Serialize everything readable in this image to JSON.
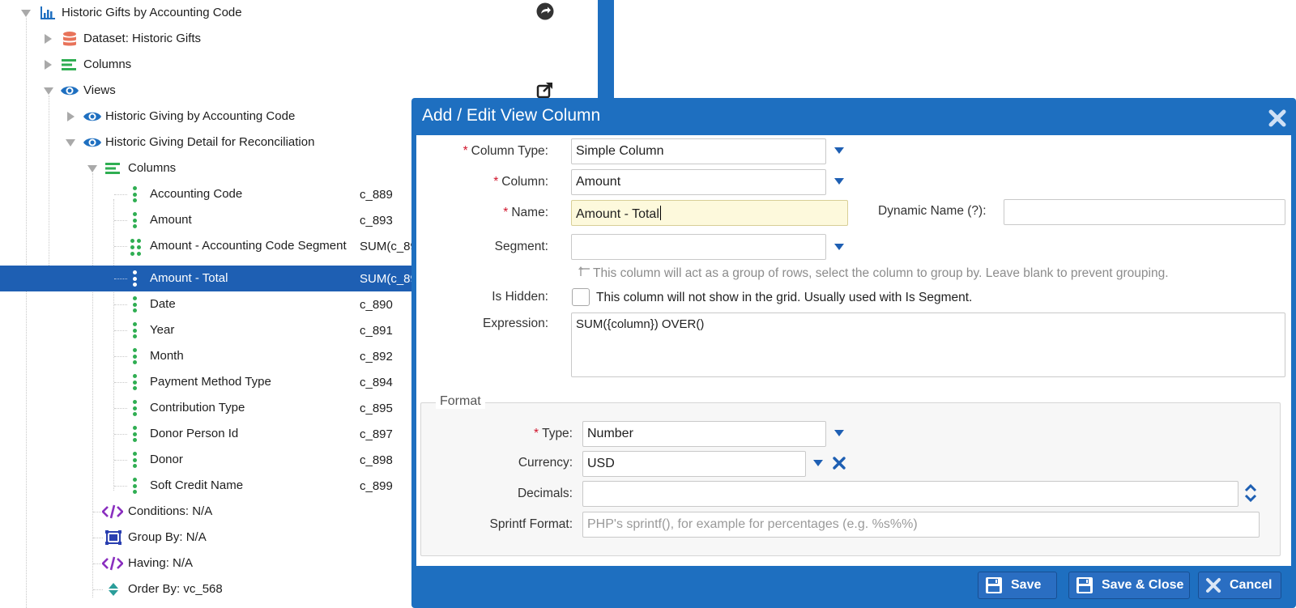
{
  "tree": {
    "root": {
      "label": "Historic Gifts by Accounting Code"
    },
    "dataset": {
      "label": "Dataset: Historic Gifts"
    },
    "columns": {
      "label": "Columns"
    },
    "views": {
      "label": "Views"
    },
    "view1": {
      "label": "Historic Giving by Accounting Code"
    },
    "view2": {
      "label": "Historic Giving Detail for Reconciliation"
    },
    "view2_columns": {
      "label": "Columns"
    },
    "column_items": [
      {
        "label": "Accounting Code",
        "code": "c_889"
      },
      {
        "label": "Amount",
        "code": "c_893"
      },
      {
        "label": "Amount - Accounting Code Segment",
        "code": "SUM(c_89"
      },
      {
        "label": "Amount - Total",
        "code": "SUM(c_89"
      },
      {
        "label": "Date",
        "code": "c_890"
      },
      {
        "label": "Year",
        "code": "c_891"
      },
      {
        "label": "Month",
        "code": "c_892"
      },
      {
        "label": "Payment Method Type",
        "code": "c_894"
      },
      {
        "label": "Contribution Type",
        "code": "c_895"
      },
      {
        "label": "Donor Person Id",
        "code": "c_897"
      },
      {
        "label": "Donor",
        "code": "c_898"
      },
      {
        "label": "Soft Credit Name",
        "code": "c_899"
      }
    ],
    "conditions": {
      "label": "Conditions: N/A"
    },
    "group_by": {
      "label": "Group By: N/A"
    },
    "having": {
      "label": "Having: N/A"
    },
    "order_by": {
      "label": "Order By: vc_568"
    }
  },
  "dialog": {
    "title": "Add / Edit View Column",
    "fields": {
      "column_type": {
        "label": "Column Type:",
        "value": "Simple Column"
      },
      "column": {
        "label": "Column:",
        "value": "Amount"
      },
      "name": {
        "label": "Name:",
        "value": "Amount - Total"
      },
      "dynamic_name": {
        "label": "Dynamic Name (?):",
        "value": ""
      },
      "segment": {
        "label": "Segment:",
        "value": "",
        "hint": "This column will act as a group of rows, select the column to group by. Leave blank to prevent grouping."
      },
      "is_hidden": {
        "label": "Is Hidden:",
        "checked": false,
        "hint": "This column will not show in the grid. Usually used with Is Segment."
      },
      "expression": {
        "label": "Expression:",
        "value": "SUM({column}) OVER()"
      }
    },
    "format": {
      "legend": "Format",
      "type": {
        "label": "Type:",
        "value": "Number"
      },
      "currency": {
        "label": "Currency:",
        "value": "USD"
      },
      "decimals": {
        "label": "Decimals:",
        "value": ""
      },
      "sprintf": {
        "label": "Sprintf Format:",
        "placeholder": "PHP's sprintf(), for example for percentages (e.g. %s%%)"
      }
    },
    "buttons": {
      "save": "Save",
      "save_close": "Save & Close",
      "cancel": "Cancel"
    }
  },
  "colors": {
    "accent_blue": "#1e6fc0",
    "selection": "#1e5fb3",
    "green_icon": "#2fae52",
    "required": "#d0152c",
    "purple_icon": "#8a2fbf"
  },
  "icons": [
    "chart-icon",
    "database-icon",
    "list-icon",
    "eye-icon",
    "dots-icon",
    "grid-dots-icon",
    "code-icon",
    "group-icon",
    "sort-icon",
    "arrow-circle-icon",
    "external-link-icon",
    "close-icon",
    "save-icon",
    "cancel-icon"
  ]
}
